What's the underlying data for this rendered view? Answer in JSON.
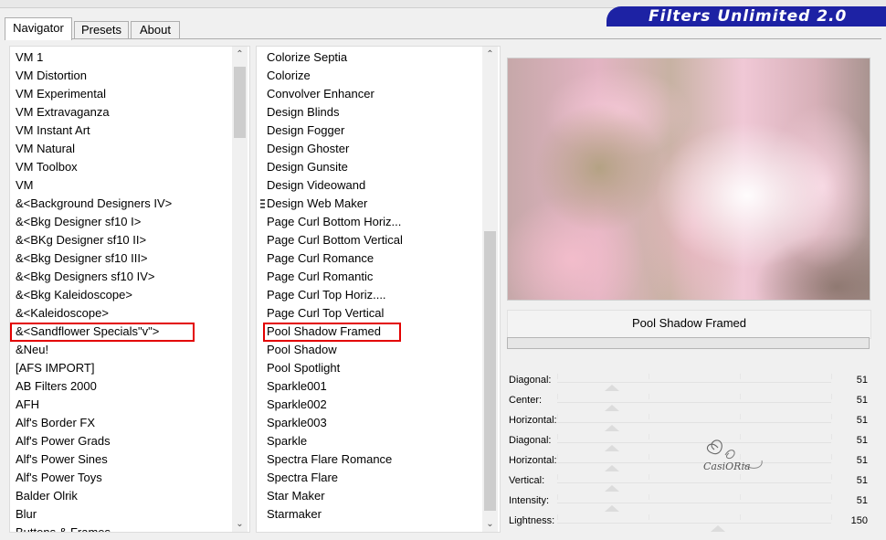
{
  "window": {
    "title": "Filters Unlimited 2.0"
  },
  "tabs": [
    {
      "label": "Navigator",
      "active": true
    },
    {
      "label": "Presets",
      "active": false
    },
    {
      "label": "About",
      "active": false
    }
  ],
  "categories": [
    "VM 1",
    "VM Distortion",
    "VM Experimental",
    "VM Extravaganza",
    "VM Instant Art",
    "VM Natural",
    "VM Toolbox",
    "VM",
    "&<Background Designers IV>",
    "&<Bkg Designer sf10 I>",
    "&<BKg Designer sf10 II>",
    "&<Bkg Designer sf10 III>",
    "&<Bkg Designers sf10 IV>",
    "&<Bkg Kaleidoscope>",
    "&<Kaleidoscope>",
    "&<Sandflower Specials\"v\">",
    "&Neu!",
    "[AFS IMPORT]",
    "AB Filters 2000",
    "AFH",
    "Alf's Border FX",
    "Alf's Power Grads",
    "Alf's Power Sines",
    "Alf's Power Toys",
    "Balder Olrik",
    "Blur",
    "Buttons & Frames"
  ],
  "selected_category": "&<Sandflower Specials\"v\">",
  "filters": [
    "Colorize Septia",
    "Colorize",
    "Convolver Enhancer",
    "Design Blinds",
    "Design Fogger",
    "Design Ghoster",
    "Design Gunsite",
    "Design Videowand",
    "Design Web Maker",
    "Page Curl Bottom Horiz...",
    "Page Curl Bottom Vertical",
    "Page Curl Romance",
    "Page Curl Romantic",
    "Page Curl Top Horiz....",
    "Page Curl Top Vertical",
    "Pool Shadow Framed",
    "Pool Shadow",
    "Pool Spotlight",
    "Sparkle001",
    "Sparkle002",
    "Sparkle003",
    "Sparkle",
    "Spectra Flare Romance",
    "Spectra Flare",
    "Star Maker",
    "Starmaker"
  ],
  "selected_filter": "Pool Shadow Framed",
  "filter_name": "Pool Shadow Framed",
  "parameters": [
    {
      "label": "Diagonal:",
      "value": 51
    },
    {
      "label": "Center:",
      "value": 51
    },
    {
      "label": "Horizontal:",
      "value": 51
    },
    {
      "label": "Diagonal:",
      "value": 51
    },
    {
      "label": "Horizontal:",
      "value": 51
    },
    {
      "label": "Vertical:",
      "value": 51
    },
    {
      "label": "Intensity:",
      "value": 51
    },
    {
      "label": "Lightness:",
      "value": 150
    }
  ],
  "slider_max": 255,
  "watermark": {
    "text": "CasiORia"
  },
  "icons": {
    "scroll_up": "chevron-up-icon",
    "scroll_down": "chevron-down-icon",
    "drag_handle": "grip-icon"
  }
}
